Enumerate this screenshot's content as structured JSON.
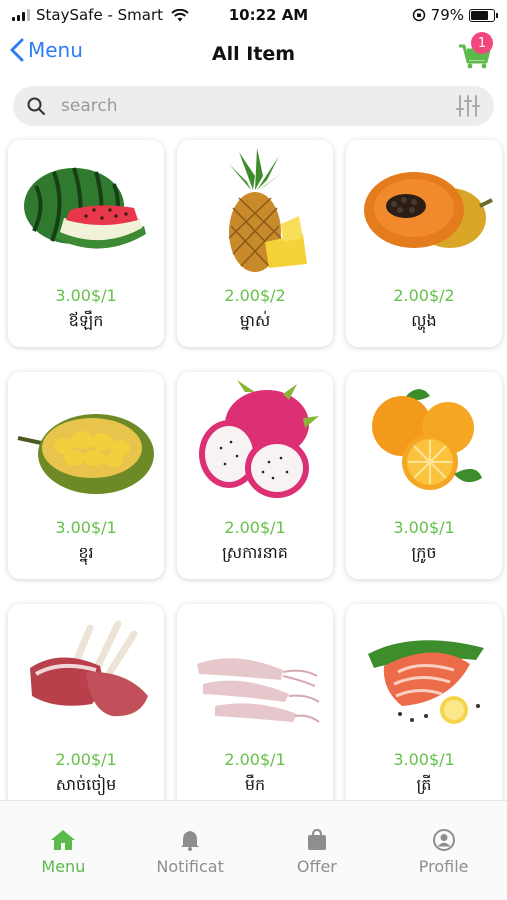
{
  "status": {
    "carrier": "StaySafe - Smart",
    "time": "10:22 AM",
    "battery": "79%",
    "battery_level": 0.79
  },
  "nav": {
    "back_label": "Menu",
    "title": "All Item",
    "cart_count": "1"
  },
  "search": {
    "placeholder": "search"
  },
  "items": [
    {
      "price": "3.00$/1",
      "name": "ឪឡឹក",
      "icon": "watermelon"
    },
    {
      "price": "2.00$/2",
      "name": "ម្នាស់",
      "icon": "pineapple"
    },
    {
      "price": "2.00$/2",
      "name": "ល្ហុង",
      "icon": "papaya"
    },
    {
      "price": "3.00$/1",
      "name": "ខ្នុរ",
      "icon": "jackfruit"
    },
    {
      "price": "2.00$/1",
      "name": "ស្រការនាគ",
      "icon": "dragon-fruit"
    },
    {
      "price": "3.00$/1",
      "name": "ក្រូច",
      "icon": "orange"
    },
    {
      "price": "2.00$/1",
      "name": "សាច់ចៀម",
      "icon": "lamb-rack"
    },
    {
      "price": "2.00$/1",
      "name": "មឹក",
      "icon": "squid"
    },
    {
      "price": "3.00$/1",
      "name": "ត្រី",
      "icon": "salmon"
    }
  ],
  "tabs": [
    {
      "label": "Menu",
      "icon": "home-icon"
    },
    {
      "label": "Notificat",
      "icon": "bell-icon"
    },
    {
      "label": "Offer",
      "icon": "shopping-bag-icon"
    },
    {
      "label": "Profile",
      "icon": "profile-icon"
    }
  ],
  "colors": {
    "accent": "#5cb94b",
    "price": "#66c04a",
    "link": "#2f7cf6",
    "badge": "#f2477d"
  }
}
